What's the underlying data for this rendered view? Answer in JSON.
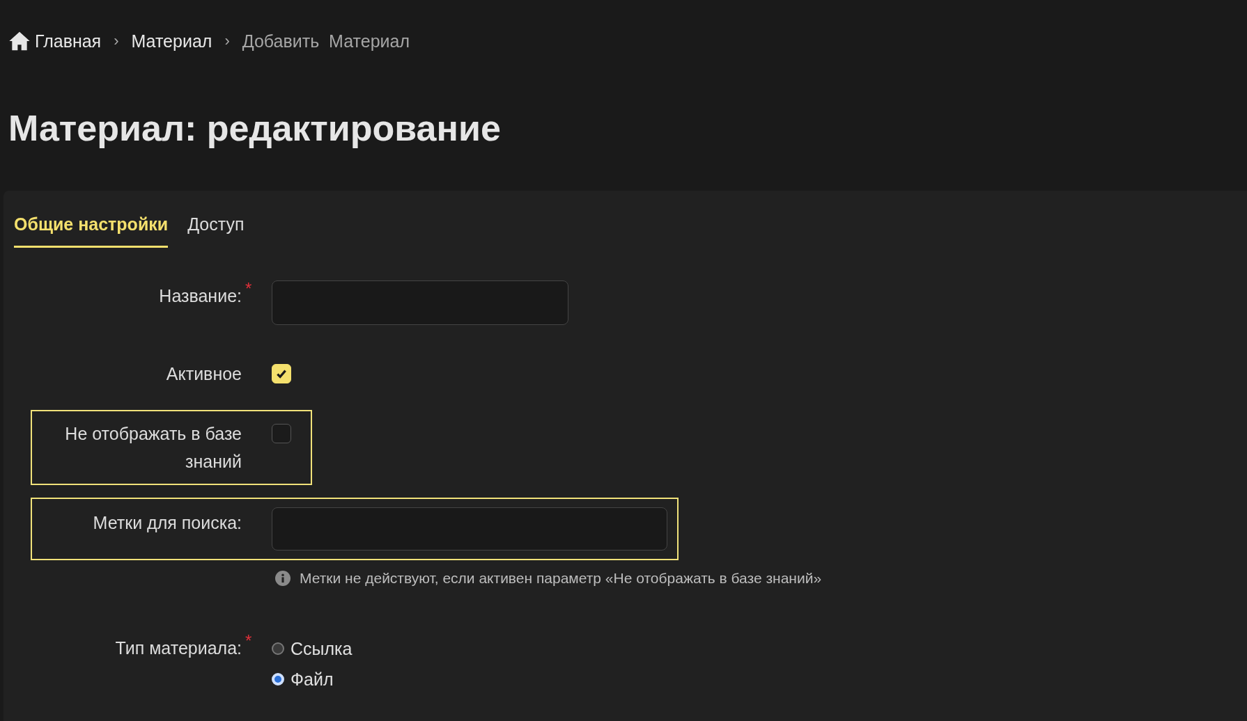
{
  "breadcrumbs": [
    {
      "kind": "home",
      "label": "Главная"
    },
    {
      "kind": "link",
      "separator": "›",
      "label": "Материал"
    },
    {
      "kind": "current",
      "separator": "›",
      "label": "Добавить  Материал"
    }
  ],
  "title": "Материал: редактирование",
  "tabs": [
    {
      "label": "Общие настройки",
      "selected": true
    },
    {
      "label": "Доступ",
      "selected": false
    }
  ],
  "fields": [
    {
      "kind": "text",
      "label": "Название:",
      "required_mark": "*",
      "highlighted": false
    },
    {
      "kind": "checkbox",
      "label": "Активное",
      "highlighted": false,
      "checked": true
    },
    {
      "kind": "checkbox",
      "label": "Не отображать в базе знаний",
      "highlighted": true,
      "checked": false
    },
    {
      "kind": "text",
      "label": "Метки для поиска:",
      "highlighted": true,
      "hint": "Метки не действуют, если активен параметр «Не отображать в базе знаний»"
    },
    {
      "kind": "radio",
      "label": "Тип материала:",
      "required_mark": "*",
      "highlighted": false,
      "options": [
        {
          "label": "Ссылка",
          "selected": false
        },
        {
          "label": "Файл",
          "selected": true
        }
      ]
    }
  ]
}
